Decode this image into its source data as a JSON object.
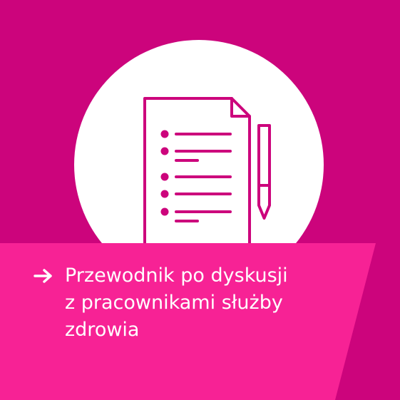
{
  "tile": {
    "label_lines": [
      "Przewodnik po dyskusji",
      "z pracownikami służby",
      "zdrowia"
    ],
    "icon": "document-checklist-with-pen-icon",
    "arrow_icon": "arrow-right-icon"
  },
  "colors": {
    "background": "#cc047c",
    "label_panel": "#f72295",
    "circle": "#ffffff",
    "icon_stroke": "#cc047c",
    "text": "#ffffff"
  }
}
